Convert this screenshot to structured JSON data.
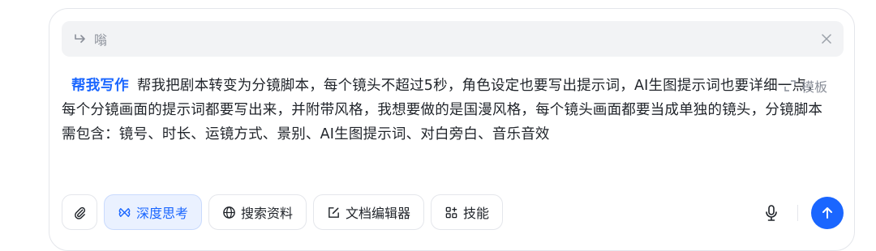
{
  "quote": {
    "text": "嗡"
  },
  "prompt": {
    "tag": "帮我写作",
    "text": "帮我把剧本转变为分镜脚本，每个镜头不超过5秒，角色设定也要写出提示词，AI生图提示词也要详细一点，每个分镜画面的提示词都要写出来，并附带风格，我想要做的是国漫风格，每个镜头画面都要当成单独的镜头，分镜脚本需包含：镜号、时长、运镜方式、景别、AI生图提示词、对白旁白、音乐音效"
  },
  "template": {
    "label": "模板"
  },
  "toolbar": {
    "deep_think": "深度思考",
    "search": "搜索资料",
    "doc_editor": "文档编辑器",
    "skills": "技能"
  },
  "colors": {
    "accent": "#1a66ff",
    "muted": "#8a8f99",
    "text": "#1f2329"
  },
  "icons": [
    "reply-icon",
    "close-icon",
    "expand-icon",
    "paperclip-icon",
    "deep-think-icon",
    "globe-icon",
    "edit-doc-icon",
    "skills-grid-icon",
    "microphone-icon",
    "arrow-up-icon"
  ]
}
